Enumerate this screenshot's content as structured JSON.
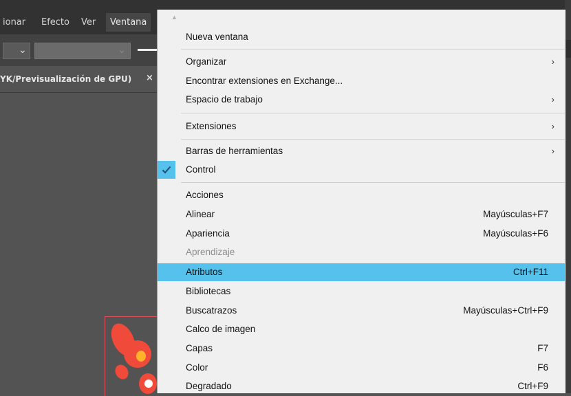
{
  "menubar": {
    "items": [
      "ionar",
      "Efecto",
      "Ver",
      "Ventana"
    ]
  },
  "document_tab": {
    "title": "YK/Previsualización de GPU)",
    "close_symbol": "×"
  },
  "menu": {
    "scroll_up_symbol": "▲",
    "items": [
      {
        "label": "Nueva ventana"
      },
      {
        "label": "Organizar",
        "submenu": true
      },
      {
        "label": "Encontrar extensiones en Exchange..."
      },
      {
        "label": "Espacio de trabajo",
        "submenu": true
      },
      {
        "label": "Extensiones",
        "submenu": true
      },
      {
        "label": "Barras de herramientas",
        "submenu": true
      },
      {
        "label": "Control",
        "checked": true
      },
      {
        "label": "Acciones"
      },
      {
        "label": "Alinear",
        "shortcut": "Mayúsculas+F7"
      },
      {
        "label": "Apariencia",
        "shortcut": "Mayúsculas+F6"
      },
      {
        "label": "Aprendizaje",
        "disabled": true
      },
      {
        "label": "Atributos",
        "shortcut": "Ctrl+F11",
        "highlighted": true
      },
      {
        "label": "Bibliotecas"
      },
      {
        "label": "Buscatrazos",
        "shortcut": "Mayúsculas+Ctrl+F9"
      },
      {
        "label": "Calco de imagen"
      },
      {
        "label": "Capas",
        "shortcut": "F7"
      },
      {
        "label": "Color",
        "shortcut": "F6"
      },
      {
        "label": "Degradado",
        "shortcut": "Ctrl+F9"
      }
    ],
    "submenu_arrow": "›",
    "highlight_color": "#55c1ec"
  }
}
